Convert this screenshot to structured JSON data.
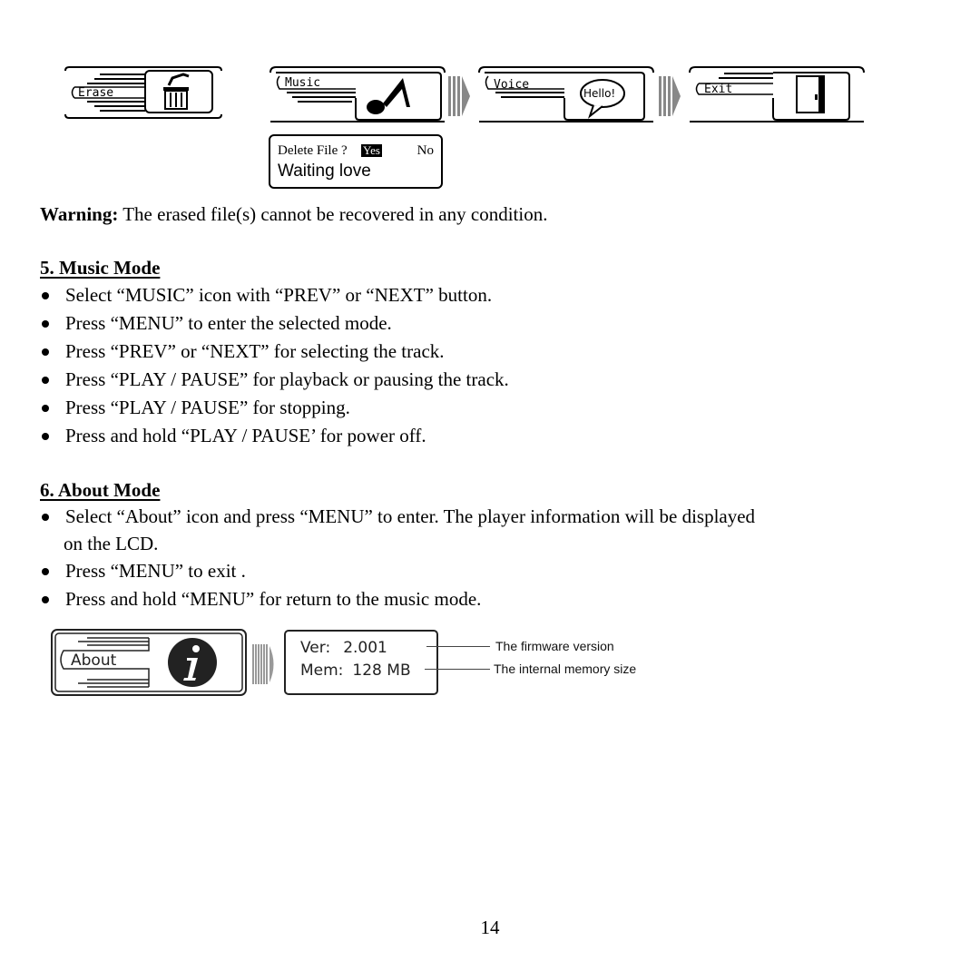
{
  "menu_icons": {
    "erase": {
      "label": "Erase",
      "icon": "trash-can-icon"
    },
    "music": {
      "label": "Music",
      "icon": "music-note-icon"
    },
    "voice": {
      "label": "Voice",
      "icon": "speech-bubble-icon",
      "bubble_text": "Hello!"
    },
    "exit": {
      "label": "Exit",
      "icon": "door-icon"
    }
  },
  "delete_dialog": {
    "question": "Delete File ?",
    "yes": "Yes",
    "no": "No",
    "track": "Waiting love",
    "selected": "Yes"
  },
  "warning": {
    "label": "Warning:",
    "text": " The erased file(s) cannot be recovered in any condition."
  },
  "sections": [
    {
      "heading": "5. Music Mode",
      "bullets": [
        "Select “MUSIC” icon with “PREV” or “NEXT” button.",
        "Press “MENU” to enter the selected mode.",
        "Press “PREV” or “NEXT” for selecting the track.",
        "Press “PLAY / PAUSE” for playback or pausing the track.",
        "Press “PLAY / PAUSE” for stopping.",
        "Press and hold “PLAY / PAUSE’ for power off."
      ]
    },
    {
      "heading": "6. About Mode",
      "bullets": [
        "Select “About” icon and press “MENU” to enter. The player information will be displayed",
        "Press “MENU” to exit .",
        "Press and hold “MENU” for return to the music mode."
      ],
      "bullet_0_continuation": "on the LCD."
    }
  ],
  "about_screen": {
    "icon_label": "About",
    "icon": "info-icon",
    "ver_label": "Ver:",
    "ver_value": "2.001",
    "mem_label": "Mem:",
    "mem_value": "128 MB",
    "callouts": [
      "The firmware version",
      "The internal memory size"
    ]
  },
  "page_number": "14"
}
